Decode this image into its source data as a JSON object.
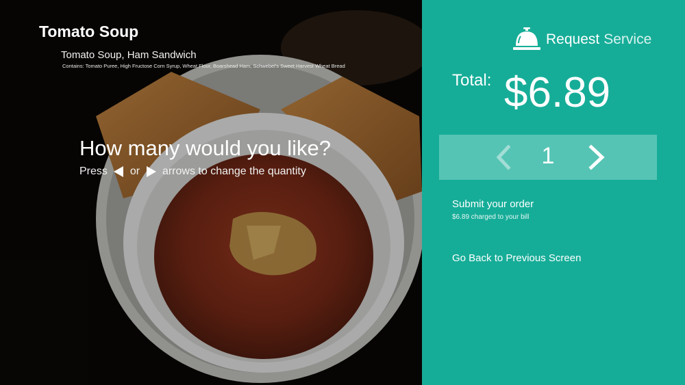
{
  "item": {
    "title": "Tomato Soup",
    "subtitle": "Tomato Soup, Ham Sandwich",
    "contents": "Contains: Tomato Puree, High Fructose Corn Syrup, Wheat Flour, Boarshead Ham, Schwebel's Sweet Harvest Wheat Bread"
  },
  "prompt": {
    "question": "How many would you like?",
    "press": "Press",
    "or": "or",
    "rest": "arrows to change the quantity"
  },
  "service": {
    "request_bold": "Request",
    "request_light": "Service"
  },
  "order": {
    "total_label": "Total:",
    "total_amount": "$6.89",
    "quantity": "1",
    "submit_label": "Submit your order",
    "submit_note": "$6.89 charged to your bill",
    "back_label": "Go Back to Previous Screen"
  },
  "colors": {
    "panel": "#16ad98",
    "quantity_box": "rgba(255,255,255,0.28)"
  },
  "icons": {
    "bell": "service-bell-icon",
    "decrement": "chevron-left-icon",
    "increment": "chevron-right-icon",
    "press_left": "triangle-left-icon",
    "press_right": "triangle-right-icon"
  }
}
